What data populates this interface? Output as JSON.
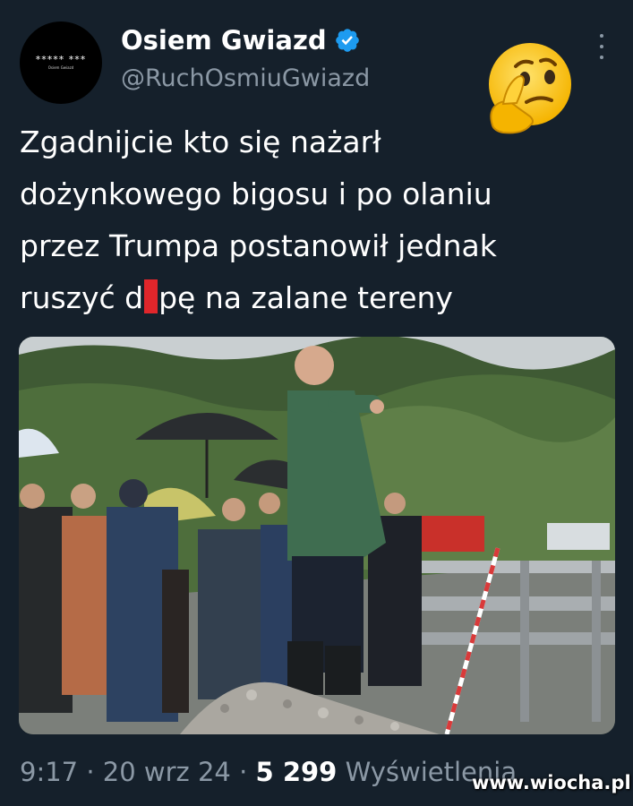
{
  "author": {
    "display_name": "Osiem Gwiazd",
    "handle": "@RuchOsmiuGwiazd",
    "avatar_stars": "***** ***",
    "avatar_brand": "Osiem Gwiazd"
  },
  "icons": {
    "verified": "verified-badge-icon",
    "more": "more-options-icon",
    "emoji": "thinking-face-emoji"
  },
  "tweet": {
    "text_line1": "Zgadnijcie kto się nażarł",
    "text_line2": "dożynkowego bigosu i po olaniu",
    "text_line3": "przez Trumpa postanowił jednak",
    "text_line4_before": "ruszyć d",
    "text_line4_after": "pę na zalane tereny"
  },
  "meta": {
    "time": "9:17",
    "sep1": " · ",
    "date": "20 wrz 24",
    "sep2": " · ",
    "views_count": "5 299",
    "views_label": " Wyświetlenia"
  },
  "watermark": "www.wiocha.pl",
  "colors": {
    "background": "#15202b",
    "verified": "#1d9bf0",
    "secondary_text": "#8b98a5",
    "censor_bar": "#e0262b"
  }
}
